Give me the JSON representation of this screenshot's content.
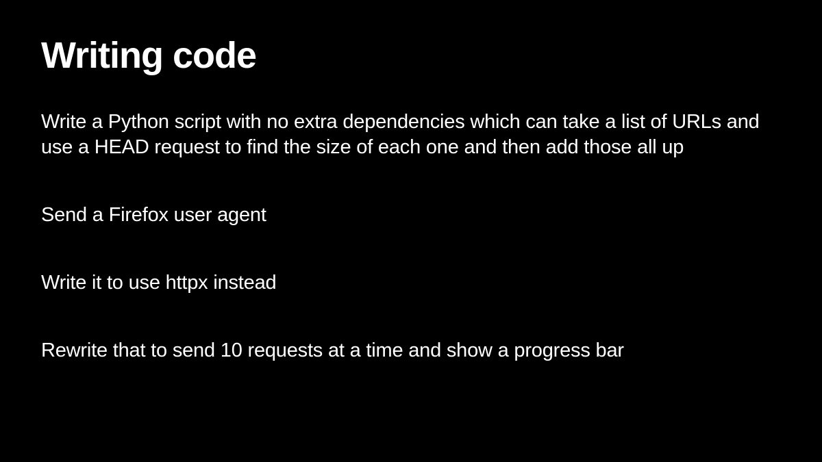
{
  "slide": {
    "title": "Writing code",
    "paragraphs": [
      "Write a Python script with no extra dependencies which can take a list of URLs and use a HEAD request to find the size of each one and then add those all up",
      "Send a Firefox user agent",
      "Write it to use httpx instead",
      "Rewrite that to send 10 requests at a time and show a progress bar"
    ]
  }
}
